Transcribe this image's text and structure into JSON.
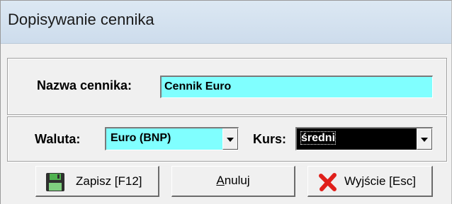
{
  "window": {
    "title": "Dopisywanie cennika"
  },
  "form": {
    "nazwa": {
      "label": "Nazwa cennika:",
      "value": "Cennik Euro"
    },
    "waluta": {
      "label": "Waluta:",
      "value": "Euro (BNP)"
    },
    "kurs": {
      "label": "Kurs:",
      "value": "średni"
    }
  },
  "buttons": {
    "zapisz": {
      "label": "Zapisz  [F12]",
      "icon": "floppy-disk-icon"
    },
    "anuluj": {
      "label_underlined": "A",
      "label_rest": "nuluj"
    },
    "wyjscie": {
      "label": "Wyjście  [Esc]",
      "icon": "close-x-icon"
    }
  },
  "colors": {
    "input_bg": "#80ffff",
    "selected_bg": "#000000",
    "close_icon": "#e0201b",
    "floppy_icon": "#3a8a3a"
  }
}
